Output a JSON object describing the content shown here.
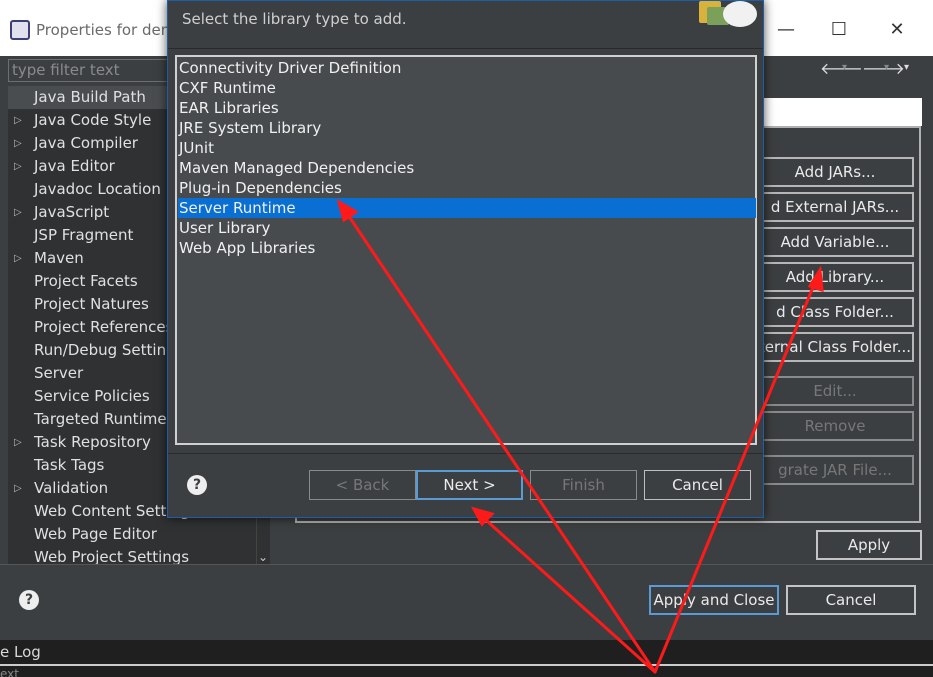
{
  "window": {
    "title": "Properties for dem",
    "controls": [
      "—",
      "☐",
      "✕"
    ]
  },
  "filter": {
    "placeholder": "type filter text"
  },
  "tree": {
    "items": [
      {
        "label": "Java Build Path",
        "expandable": false,
        "selected": true
      },
      {
        "label": "Java Code Style",
        "expandable": true
      },
      {
        "label": "Java Compiler",
        "expandable": true
      },
      {
        "label": "Java Editor",
        "expandable": true
      },
      {
        "label": "Javadoc Location",
        "expandable": false
      },
      {
        "label": "JavaScript",
        "expandable": true
      },
      {
        "label": "JSP Fragment",
        "expandable": false
      },
      {
        "label": "Maven",
        "expandable": true
      },
      {
        "label": "Project Facets",
        "expandable": false
      },
      {
        "label": "Project Natures",
        "expandable": false
      },
      {
        "label": "Project References",
        "expandable": false
      },
      {
        "label": "Run/Debug Settings",
        "expandable": false
      },
      {
        "label": "Server",
        "expandable": false
      },
      {
        "label": "Service Policies",
        "expandable": false
      },
      {
        "label": "Targeted Runtimes",
        "expandable": false
      },
      {
        "label": "Task Repository",
        "expandable": true
      },
      {
        "label": "Task Tags",
        "expandable": false
      },
      {
        "label": "Validation",
        "expandable": true
      },
      {
        "label": "Web Content Settings",
        "expandable": false
      },
      {
        "label": "Web Page Editor",
        "expandable": false
      },
      {
        "label": "Web Project Settings",
        "expandable": false
      }
    ]
  },
  "side_buttons": [
    {
      "label": "Add JARs...",
      "enabled": true
    },
    {
      "label": "d External JARs...",
      "enabled": true
    },
    {
      "label": "Add Variable...",
      "enabled": true
    },
    {
      "label": "Add Library...",
      "enabled": true
    },
    {
      "label": "d Class Folder...",
      "enabled": true
    },
    {
      "label": "ternal Class Folder...",
      "enabled": true
    },
    {
      "label": "Edit...",
      "enabled": false
    },
    {
      "label": "Remove",
      "enabled": false
    },
    {
      "label": "grate JAR File...",
      "enabled": false
    }
  ],
  "apply_label": "Apply",
  "footer": {
    "apply_close": "Apply and Close",
    "cancel": "Cancel"
  },
  "bottom": {
    "console_log": "e Log",
    "tail": "ext"
  },
  "dialog": {
    "message": "Select the library type to add.",
    "library_types": [
      "Connectivity Driver Definition",
      "CXF Runtime",
      "EAR Libraries",
      "JRE System Library",
      "JUnit",
      "Maven Managed Dependencies",
      "Plug-in Dependencies",
      "Server Runtime",
      "User Library",
      "Web App Libraries"
    ],
    "selected_type": "Server Runtime",
    "buttons": {
      "back": "< Back",
      "next": "Next >",
      "finish": "Finish",
      "cancel": "Cancel"
    }
  },
  "colors": {
    "annotation": "#ff1a1a",
    "selection": "#0a6fd3",
    "focus_border": "#5b9bd5"
  },
  "icons": [
    "help-icon",
    "back-arrow-icon",
    "forward-arrow-icon",
    "chevron-down-icon",
    "expand-triangle-icon",
    "scroll-down-icon"
  ]
}
